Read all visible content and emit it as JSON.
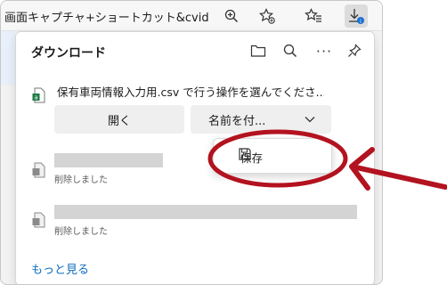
{
  "browser": {
    "tab_title": "画面キャプチャ+ショートカット&cvid..."
  },
  "downloads_panel": {
    "title": "ダウンロード",
    "items": [
      {
        "text": "保有車両情報入力用.csv で行う操作を選んでくださ...",
        "open_label": "開く",
        "saveas_label": "名前を付..."
      },
      {
        "status": "削除しました"
      },
      {
        "status": "削除しました"
      }
    ],
    "see_more": "もっと見る"
  },
  "save_menu": {
    "save_label": "保存"
  },
  "colors": {
    "annotation": "#b3121f",
    "link": "#0f6cbd"
  },
  "icons": [
    "zoom-icon",
    "add-favorite-icon",
    "favorites-icon",
    "download-icon",
    "folder-icon",
    "search-icon",
    "more-icon",
    "pin-icon",
    "csv-file-icon",
    "file-icon",
    "save-icon",
    "chevron-down-icon"
  ]
}
